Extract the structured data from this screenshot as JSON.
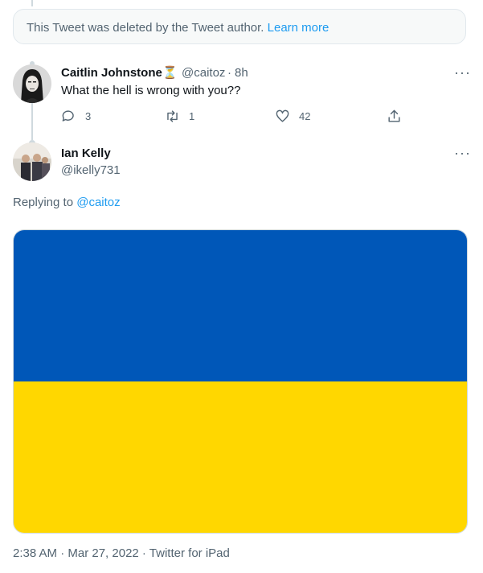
{
  "deleted_notice": {
    "text": "This Tweet was deleted by the Tweet author.",
    "link": "Learn more"
  },
  "reply_tweet": {
    "name": "Caitlin Johnstone",
    "badge": "⏳",
    "handle": "@caitoz",
    "separator": "·",
    "time": "8h",
    "text": "What the hell is wrong with you??",
    "more": "···",
    "replies": "3",
    "retweets": "1",
    "likes": "42"
  },
  "main_tweet": {
    "name": "Ian Kelly",
    "handle": "@ikelly731",
    "more": "···",
    "replying_prefix": "Replying to ",
    "replying_to": "@caitoz",
    "meta": "2:38 AM · Mar 27, 2022 · Twitter for iPad"
  },
  "colors": {
    "flag_blue": "#0057b8",
    "flag_yellow": "#ffd700",
    "link": "#1d9bf0",
    "muted": "#536471"
  }
}
